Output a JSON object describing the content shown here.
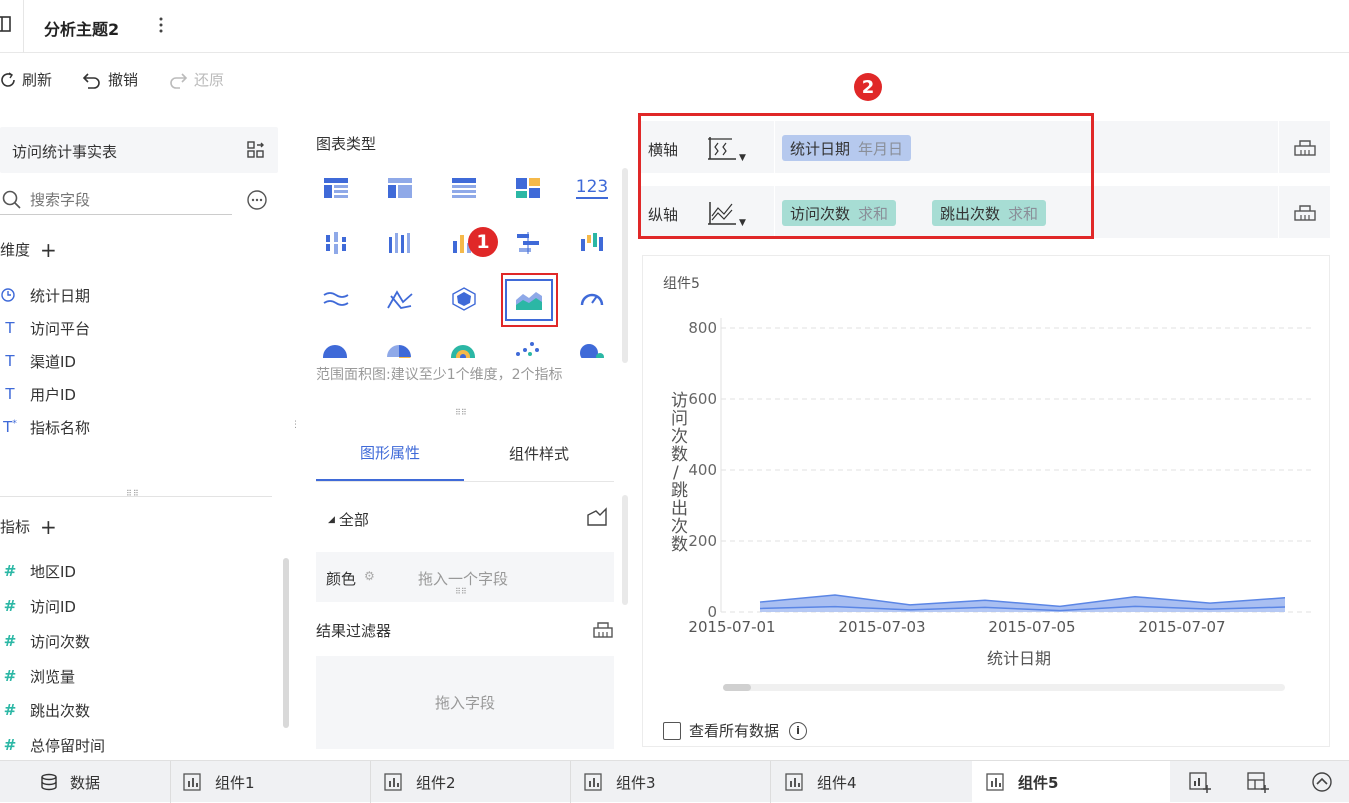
{
  "header": {
    "title": "分析主题2",
    "more_icon": "vertical-dots-icon"
  },
  "toolbar": {
    "refresh": "刷新",
    "undo": "撤销",
    "redo": "还原"
  },
  "left": {
    "table_name": "访问统计事实表",
    "search_placeholder": "搜索字段",
    "dimensions_title": "维度",
    "dimensions": [
      {
        "label": "统计日期",
        "icon": "clock-icon"
      },
      {
        "label": "访问平台",
        "icon": "text-type-icon"
      },
      {
        "label": "渠道ID",
        "icon": "text-type-icon"
      },
      {
        "label": "用户ID",
        "icon": "text-type-icon"
      },
      {
        "label": "指标名称",
        "icon": "text-type-special-icon"
      }
    ],
    "measures_title": "指标",
    "measures": [
      {
        "label": "地区ID"
      },
      {
        "label": "访问ID"
      },
      {
        "label": "访问次数"
      },
      {
        "label": "浏览量"
      },
      {
        "label": "跳出次数"
      },
      {
        "label": "总停留时间"
      }
    ]
  },
  "middle": {
    "chart_types_title": "图表类型",
    "chart_hint": "范围面积图:建议至少1个维度，2个指标",
    "tabs": [
      "图形属性",
      "组件样式"
    ],
    "all_label": "全部",
    "color_label": "颜色",
    "drop_field_one": "拖入一个字段",
    "result_filter": "结果过滤器",
    "drop_field": "拖入字段",
    "badge1": "1",
    "number_icon_text": "123"
  },
  "right": {
    "badge2": "2",
    "x_axis_label": "横轴",
    "y_axis_label": "纵轴",
    "x_fields": [
      {
        "name": "统计日期",
        "agg": "年月日"
      }
    ],
    "y_fields": [
      {
        "name": "访问次数",
        "agg": "求和"
      },
      {
        "name": "跳出次数",
        "agg": "求和"
      }
    ],
    "component_title": "组件5",
    "view_all": "查看所有数据"
  },
  "chart_data": {
    "type": "area",
    "title": "组件5",
    "xlabel": "统计日期",
    "ylabel": "访问次数/跳出次数",
    "ylim": [
      0,
      800
    ],
    "y_ticks": [
      0,
      200,
      400,
      600,
      800
    ],
    "x_tick_labels": [
      "2015-07-01",
      "2015-07-03",
      "2015-07-05",
      "2015-07-07"
    ],
    "categories": [
      "2015-07-01",
      "2015-07-02",
      "2015-07-03",
      "2015-07-04",
      "2015-07-05",
      "2015-07-06",
      "2015-07-07",
      "2015-07-08"
    ],
    "series": [
      {
        "values": [
          28,
          48,
          20,
          33,
          16,
          43,
          25,
          40
        ]
      },
      {
        "values": [
          10,
          15,
          6,
          13,
          4,
          16,
          8,
          14
        ]
      }
    ],
    "grid": true,
    "colors": [
      "#a9bff2",
      "#5b86e5"
    ]
  },
  "bottom_tabs": {
    "data": "数据",
    "items": [
      "组件1",
      "组件2",
      "组件3",
      "组件4",
      "组件5"
    ]
  },
  "colors": {
    "accent": "#3f6ad8",
    "highlight_red": "#e02828",
    "pill_blue": "#b6c9ee",
    "pill_green": "#a7ddd4"
  }
}
